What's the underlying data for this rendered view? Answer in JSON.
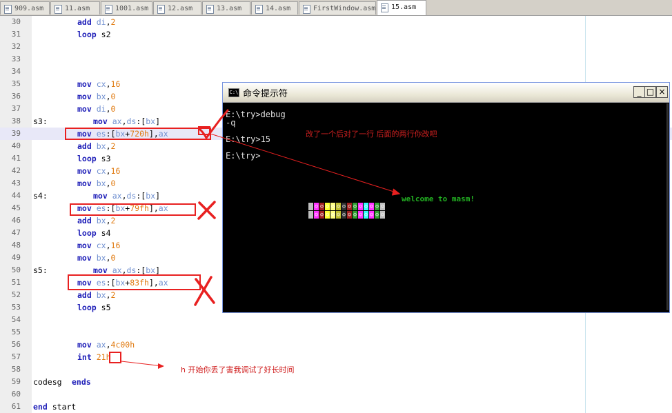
{
  "tabs": [
    {
      "label": "909.asm",
      "active": false
    },
    {
      "label": "11.asm",
      "active": false
    },
    {
      "label": "1001.asm",
      "active": false
    },
    {
      "label": "12.asm",
      "active": false
    },
    {
      "label": "13.asm",
      "active": false
    },
    {
      "label": "14.asm",
      "active": false
    },
    {
      "label": "FirstWindow.asm",
      "active": false
    },
    {
      "label": "15.asm",
      "active": true
    }
  ],
  "editor": {
    "lines": [
      {
        "n": "30",
        "label": "",
        "indent": 0,
        "ins": "add",
        "ops": [
          [
            "reg",
            "di"
          ],
          [
            "p",
            ","
          ],
          [
            "num",
            "2"
          ]
        ]
      },
      {
        "n": "31",
        "label": "",
        "indent": 0,
        "ins": "loop",
        "ops": [
          [
            "lbl",
            "s2"
          ]
        ]
      },
      {
        "n": "32",
        "label": "",
        "indent": 0,
        "ins": "",
        "ops": []
      },
      {
        "n": "33",
        "label": "",
        "indent": 0,
        "ins": "",
        "ops": []
      },
      {
        "n": "34",
        "label": "",
        "indent": 0,
        "ins": "",
        "ops": []
      },
      {
        "n": "35",
        "label": "",
        "indent": 0,
        "ins": "mov",
        "ops": [
          [
            "reg",
            "cx"
          ],
          [
            "p",
            ","
          ],
          [
            "num",
            "16"
          ]
        ]
      },
      {
        "n": "36",
        "label": "",
        "indent": 0,
        "ins": "mov",
        "ops": [
          [
            "reg",
            "bx"
          ],
          [
            "p",
            ","
          ],
          [
            "num",
            "0"
          ]
        ]
      },
      {
        "n": "37",
        "label": "",
        "indent": 0,
        "ins": "mov",
        "ops": [
          [
            "reg",
            "di"
          ],
          [
            "p",
            ","
          ],
          [
            "num",
            "0"
          ]
        ]
      },
      {
        "n": "38",
        "label": "s3:",
        "indent": 1,
        "ins": "mov",
        "ops": [
          [
            "reg",
            "ax"
          ],
          [
            "p",
            ","
          ],
          [
            "reg",
            "ds"
          ],
          [
            "p",
            ":["
          ],
          [
            "reg",
            "bx"
          ],
          [
            "p",
            "]"
          ]
        ]
      },
      {
        "n": "39",
        "label": "",
        "indent": 0,
        "ins": "mov",
        "ops": [
          [
            "reg",
            "es"
          ],
          [
            "p",
            ":["
          ],
          [
            "reg",
            "bx"
          ],
          [
            "p",
            "+"
          ],
          [
            "num",
            "720h"
          ],
          [
            "p",
            "],"
          ],
          [
            "reg",
            "ax"
          ]
        ],
        "highlight": true
      },
      {
        "n": "40",
        "label": "",
        "indent": 0,
        "ins": "add",
        "ops": [
          [
            "reg",
            "bx"
          ],
          [
            "p",
            ","
          ],
          [
            "num",
            "2"
          ]
        ]
      },
      {
        "n": "41",
        "label": "",
        "indent": 0,
        "ins": "loop",
        "ops": [
          [
            "lbl",
            "s3"
          ]
        ]
      },
      {
        "n": "42",
        "label": "",
        "indent": 0,
        "ins": "mov",
        "ops": [
          [
            "reg",
            "cx"
          ],
          [
            "p",
            ","
          ],
          [
            "num",
            "16"
          ]
        ]
      },
      {
        "n": "43",
        "label": "",
        "indent": 0,
        "ins": "mov",
        "ops": [
          [
            "reg",
            "bx"
          ],
          [
            "p",
            ","
          ],
          [
            "num",
            "0"
          ]
        ]
      },
      {
        "n": "44",
        "label": "s4:",
        "indent": 1,
        "ins": "mov",
        "ops": [
          [
            "reg",
            "ax"
          ],
          [
            "p",
            ","
          ],
          [
            "reg",
            "ds"
          ],
          [
            "p",
            ":["
          ],
          [
            "reg",
            "bx"
          ],
          [
            "p",
            "]"
          ]
        ]
      },
      {
        "n": "45",
        "label": "",
        "indent": 0,
        "ins": "mov",
        "ops": [
          [
            "reg",
            "es"
          ],
          [
            "p",
            ":["
          ],
          [
            "reg",
            "bx"
          ],
          [
            "p",
            "+"
          ],
          [
            "num",
            "79fh"
          ],
          [
            "p",
            "],"
          ],
          [
            "reg",
            "ax"
          ]
        ]
      },
      {
        "n": "46",
        "label": "",
        "indent": 0,
        "ins": "add",
        "ops": [
          [
            "reg",
            "bx"
          ],
          [
            "p",
            ","
          ],
          [
            "num",
            "2"
          ]
        ]
      },
      {
        "n": "47",
        "label": "",
        "indent": 0,
        "ins": "loop",
        "ops": [
          [
            "lbl",
            "s4"
          ]
        ]
      },
      {
        "n": "48",
        "label": "",
        "indent": 0,
        "ins": "mov",
        "ops": [
          [
            "reg",
            "cx"
          ],
          [
            "p",
            ","
          ],
          [
            "num",
            "16"
          ]
        ]
      },
      {
        "n": "49",
        "label": "",
        "indent": 0,
        "ins": "mov",
        "ops": [
          [
            "reg",
            "bx"
          ],
          [
            "p",
            ","
          ],
          [
            "num",
            "0"
          ]
        ]
      },
      {
        "n": "50",
        "label": "s5:",
        "indent": 1,
        "ins": "mov",
        "ops": [
          [
            "reg",
            "ax"
          ],
          [
            "p",
            ","
          ],
          [
            "reg",
            "ds"
          ],
          [
            "p",
            ":["
          ],
          [
            "reg",
            "bx"
          ],
          [
            "p",
            "]"
          ]
        ]
      },
      {
        "n": "51",
        "label": "",
        "indent": 0,
        "ins": "mov",
        "ops": [
          [
            "reg",
            "es"
          ],
          [
            "p",
            ":["
          ],
          [
            "reg",
            "bx"
          ],
          [
            "p",
            "+"
          ],
          [
            "num",
            "83fh"
          ],
          [
            "p",
            "],"
          ],
          [
            "reg",
            "ax"
          ]
        ]
      },
      {
        "n": "52",
        "label": "",
        "indent": 0,
        "ins": "add",
        "ops": [
          [
            "reg",
            "bx"
          ],
          [
            "p",
            ","
          ],
          [
            "num",
            "2"
          ]
        ]
      },
      {
        "n": "53",
        "label": "",
        "indent": 0,
        "ins": "loop",
        "ops": [
          [
            "lbl",
            "s5"
          ]
        ]
      },
      {
        "n": "54",
        "label": "",
        "indent": 0,
        "ins": "",
        "ops": []
      },
      {
        "n": "55",
        "label": "",
        "indent": 0,
        "ins": "",
        "ops": []
      },
      {
        "n": "56",
        "label": "",
        "indent": 0,
        "ins": "mov",
        "ops": [
          [
            "reg",
            "ax"
          ],
          [
            "p",
            ","
          ],
          [
            "num",
            "4c00h"
          ]
        ]
      },
      {
        "n": "57",
        "label": "",
        "indent": 0,
        "ins": "int",
        "ops": [
          [
            "num",
            "21h"
          ]
        ]
      },
      {
        "n": "58",
        "label": "",
        "indent": 0,
        "ins": "",
        "ops": []
      },
      {
        "n": "59",
        "label": "codesg",
        "indent": -1,
        "ins": "ends",
        "ops": []
      },
      {
        "n": "60",
        "label": "",
        "indent": 0,
        "ins": "",
        "ops": []
      },
      {
        "n": "61",
        "label": "",
        "indent": -2,
        "ins": "end",
        "ops": [
          [
            "lbl",
            "start"
          ]
        ]
      }
    ]
  },
  "cmd": {
    "title": "命令提示符",
    "minimize": "_",
    "maximize": "□",
    "close": "×",
    "output": [
      "E:\\try>debug",
      "-q",
      "",
      "E:\\try>15",
      "",
      "E:\\try>"
    ],
    "welcome": "welcome to masm!",
    "cell_colors": [
      "#ff30ff",
      "#a02020",
      "#ffff30",
      "#ffff80",
      "#c0c030",
      "#303030",
      "#a02020",
      "#30a030",
      "#ff30ff",
      "#30ffff",
      "#ff30ff",
      "#30a030",
      "#c0c0c0"
    ]
  },
  "annotations": {
    "note1": "改了一个后对了一行 后面的两行你改吧",
    "note2": "h 开始你丢了害我调试了好长时间",
    "color": "#e82020"
  }
}
